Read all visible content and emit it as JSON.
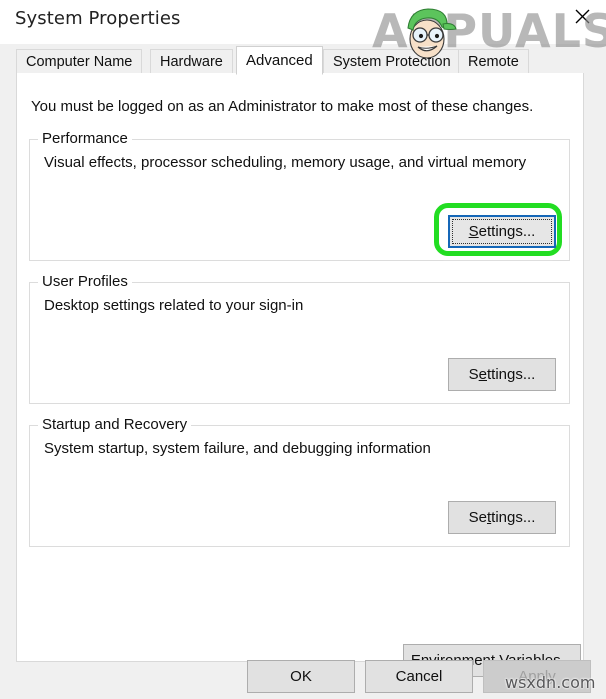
{
  "window": {
    "title": "System Properties",
    "close_icon": "close-icon"
  },
  "tabs": [
    {
      "label": "Computer Name",
      "selected": false
    },
    {
      "label": "Hardware",
      "selected": false
    },
    {
      "label": "Advanced",
      "selected": true
    },
    {
      "label": "System Protection",
      "selected": false
    },
    {
      "label": "Remote",
      "selected": false
    }
  ],
  "page": {
    "admin_notice": "You must be logged on as an Administrator to make most of these changes.",
    "groups": [
      {
        "legend": "Performance",
        "description": "Visual effects, processor scheduling, memory usage, and virtual memory",
        "button_label": "Settings...",
        "button_accel": "S",
        "button_rest": "ettings...",
        "focused": true,
        "highlighted": true
      },
      {
        "legend": "User Profiles",
        "description": "Desktop settings related to your sign-in",
        "button_label": "Settings...",
        "button_accel": "e",
        "button_pre": "S",
        "button_rest": "ttings...",
        "focused": false,
        "highlighted": false
      },
      {
        "legend": "Startup and Recovery",
        "description": "System startup, system failure, and debugging information",
        "button_label": "Settings...",
        "button_accel": "t",
        "button_pre": "Se",
        "button_rest": "tings...",
        "focused": false,
        "highlighted": false
      }
    ],
    "environment_button": {
      "label": "Environment Variables...",
      "pre": "Enviro",
      "accel": "n",
      "rest": "ment Variables..."
    }
  },
  "footer": {
    "ok_label": "OK",
    "cancel_label": "Cancel",
    "apply_label": "Apply",
    "apply_disabled": true
  },
  "watermarks": {
    "brand_text": "APPUALS",
    "site_text": "wsxdn.com"
  },
  "colors": {
    "highlight_green": "#22dd22",
    "focus_blue": "#1567b8",
    "dialog_bg": "#f0f0f0",
    "page_bg": "#ffffff",
    "button_bg": "#e1e1e1"
  }
}
